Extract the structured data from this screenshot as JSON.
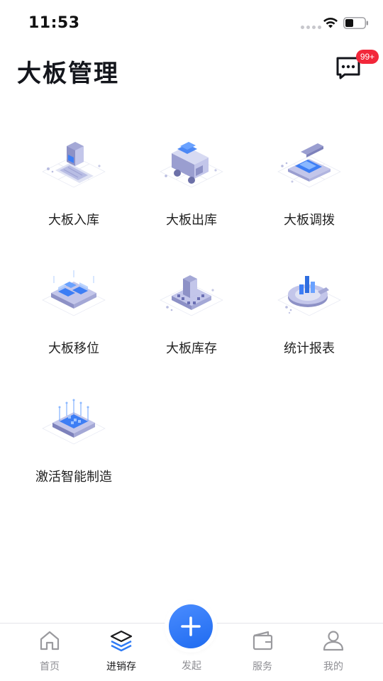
{
  "status_bar": {
    "time": "11:53"
  },
  "header": {
    "title": "大板管理",
    "message_badge": "99+"
  },
  "modules": [
    {
      "label": "大板入库",
      "icon": "warehouse-inbound-icon"
    },
    {
      "label": "大板出库",
      "icon": "truck-outbound-icon"
    },
    {
      "label": "大板调拨",
      "icon": "transfer-icon"
    },
    {
      "label": "大板移位",
      "icon": "relocate-icon"
    },
    {
      "label": "大板库存",
      "icon": "inventory-icon"
    },
    {
      "label": "统计报表",
      "icon": "statistics-chart-icon"
    },
    {
      "label": "激活智能制造",
      "icon": "smart-manufacturing-chip-icon"
    }
  ],
  "tab_bar": {
    "items": [
      {
        "label": "首页",
        "icon": "home-icon"
      },
      {
        "label": "进销存",
        "icon": "layers-icon"
      },
      {
        "label": "发起",
        "icon": "plus-icon"
      },
      {
        "label": "服务",
        "icon": "wallet-icon"
      },
      {
        "label": "我的",
        "icon": "user-icon"
      }
    ],
    "active": "进销存"
  },
  "colors": {
    "accent": "#2f7bf5",
    "badge": "#f2273a",
    "illustration": "#8f93c9"
  }
}
